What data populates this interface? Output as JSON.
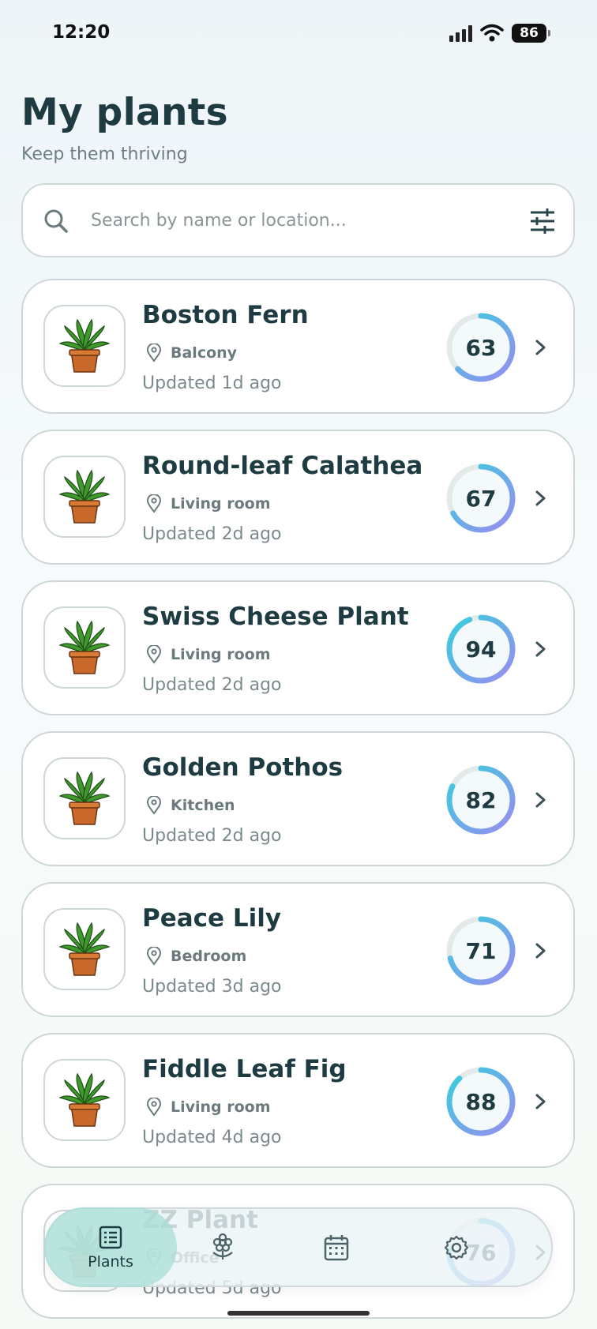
{
  "status_bar": {
    "time": "12:20",
    "battery": "86"
  },
  "header": {
    "title": "My plants",
    "subtitle": "Keep them thriving"
  },
  "search": {
    "placeholder": "Search by name or location...",
    "value": ""
  },
  "plants": [
    {
      "name": "Boston Fern",
      "location": "Balcony",
      "updated": "Updated 1d ago",
      "score": 63
    },
    {
      "name": "Round-leaf Calathea",
      "location": "Living room",
      "updated": "Updated 2d ago",
      "score": 67
    },
    {
      "name": "Swiss Cheese Plant",
      "location": "Living room",
      "updated": "Updated 2d ago",
      "score": 94
    },
    {
      "name": "Golden Pothos",
      "location": "Kitchen",
      "updated": "Updated 2d ago",
      "score": 82
    },
    {
      "name": "Peace Lily",
      "location": "Bedroom",
      "updated": "Updated 3d ago",
      "score": 71
    },
    {
      "name": "Fiddle Leaf Fig",
      "location": "Living room",
      "updated": "Updated 4d ago",
      "score": 88
    },
    {
      "name": "ZZ Plant",
      "location": "Office",
      "updated": "Updated 5d ago",
      "score": 76
    }
  ],
  "nav": {
    "items": [
      {
        "label": "Plants",
        "icon": "list-icon",
        "active": true
      },
      {
        "label": "",
        "icon": "flower-icon",
        "active": false
      },
      {
        "label": "",
        "icon": "calendar-icon",
        "active": false
      },
      {
        "label": "",
        "icon": "gear-icon",
        "active": false
      }
    ]
  },
  "colors": {
    "ring_start": "#36d0de",
    "ring_end": "#9a8cf0",
    "ring_track": "#e4e9ea",
    "title": "#1d3b40"
  }
}
